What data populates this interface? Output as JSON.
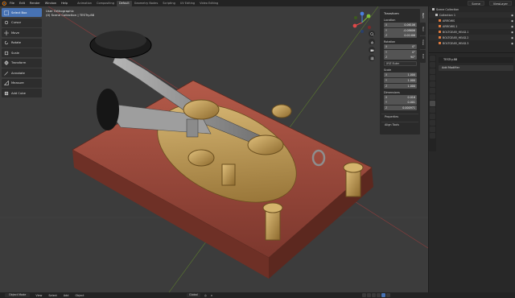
{
  "topbar": {
    "menus": [
      "File",
      "Edit",
      "Render",
      "Window",
      "Help"
    ],
    "workspaces": [
      "Animation",
      "Compositing",
      "Default",
      "Geometry Nodes",
      "Scripting",
      "UV Editing",
      "Video Editing"
    ],
    "active_workspace": "Default",
    "scene_label": "Scene",
    "layer_label": "ViewLayer"
  },
  "viewport": {
    "view_name": "User Orthographic",
    "collection_path": "(0) Scene Collection | TESTry.88"
  },
  "toolbar": {
    "tools": [
      {
        "label": "Select Box",
        "icon": "select-box-icon",
        "active": true
      },
      {
        "label": "Cursor",
        "icon": "cursor-icon",
        "active": false
      },
      {
        "label": "Move",
        "icon": "move-icon",
        "active": false
      },
      {
        "label": "Rotate",
        "icon": "rotate-icon",
        "active": false
      },
      {
        "label": "Scale",
        "icon": "scale-icon",
        "active": false
      },
      {
        "label": "Transform",
        "icon": "transform-icon",
        "active": false
      },
      {
        "label": "Annotate",
        "icon": "annotate-icon",
        "active": false
      },
      {
        "label": "Measure",
        "icon": "measure-icon",
        "active": false
      },
      {
        "label": "Add Cube",
        "icon": "add-cube-icon",
        "active": false
      }
    ]
  },
  "npanel": {
    "title": "Transform",
    "location": {
      "label": "Location",
      "x": "0.06106",
      "y": "-0.08606",
      "z": "0.01406"
    },
    "rotation": {
      "label": "Rotation",
      "x": "0°",
      "y": "0°",
      "z": "90°"
    },
    "rotation_mode": "XYZ Euler",
    "scale": {
      "label": "Scale",
      "x": "1.000",
      "y": "1.000",
      "z": "1.000"
    },
    "dimensions": {
      "label": "Dimensions",
      "x": "0.016",
      "y": "0.001",
      "z": "0.000971"
    },
    "sub_panels": [
      "Properties",
      "Align Tools"
    ],
    "tabs": [
      "Item",
      "Tool",
      "View",
      "Edit"
    ],
    "active_tab": "Item"
  },
  "outliner": {
    "header": "Scene Collection",
    "rows": [
      {
        "label": "Collection 1",
        "color": "#bcbcbc"
      },
      {
        "label": "ARROWS",
        "color": "#e07a3d"
      },
      {
        "label": "ARROWS.1",
        "color": "#e07a3d"
      },
      {
        "label": "BOLTGEAR_HEAD.1",
        "color": "#e07a3d"
      },
      {
        "label": "BOLTGEAR_HEAD.2",
        "color": "#e07a3d"
      },
      {
        "label": "BOLTGEAR_HEAD.3",
        "color": "#e07a3d"
      }
    ]
  },
  "properties": {
    "object_name": "TESTry.88",
    "add_modifier_label": "Add Modifier"
  },
  "statusbar": {
    "mode": "Object Mode",
    "menus": [
      "View",
      "Select",
      "Add",
      "Object"
    ],
    "orientation": "Global",
    "pivot_icon": "pivot-icon",
    "snap_icon": "magnet-icon"
  },
  "colors": {
    "accent": "#4772b3",
    "base_wood": "#9b4b3e",
    "brass": "#c9a25a",
    "steel": "#8e8e8e",
    "knob_black": "#1a1a1a"
  }
}
